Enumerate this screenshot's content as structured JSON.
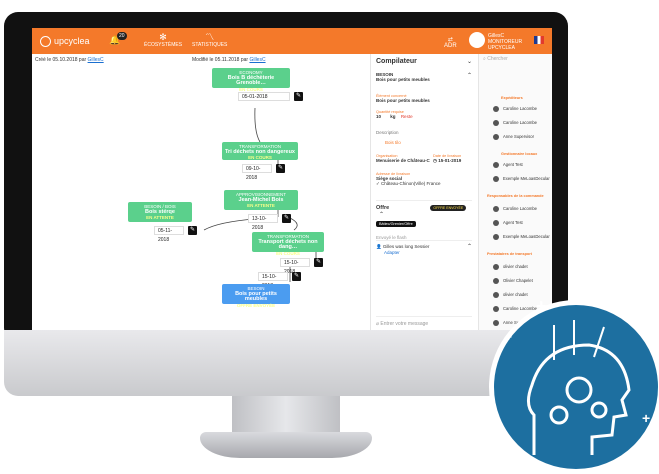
{
  "topbar": {
    "logo": "upcyclea",
    "notification_count": "20",
    "nav": [
      {
        "label": "ÉCOSYSTÈMES",
        "icon": "ecosystem-icon"
      },
      {
        "label": "STATISTIQUES",
        "icon": "stats-icon"
      }
    ],
    "adr_label": "ADR",
    "user_name": "GillesC",
    "user_role": "MONITOREUR",
    "user_org": "UPCYCLEA"
  },
  "meta": {
    "created_prefix": "Créé le 05.10.2018 par",
    "created_by": "GillesC",
    "modified_prefix": "Modifié le 05.11.2018 par",
    "modified_by": "GillesC"
  },
  "graph": {
    "nodes": [
      {
        "title": "ECONOMY",
        "name": "Bois B déchèterie Grenoble…",
        "status": "EN COURS",
        "color": "#5bd08c"
      },
      {
        "title": "TRANSFORMATION",
        "name": "Tri déchets non dangereux",
        "status": "EN COURS",
        "color": "#5bd08c"
      },
      {
        "title": "APPROVISIONNEMENT",
        "name": "Jean-Michel Bois",
        "status": "EN ATTENTE",
        "color": "#5bd08c"
      },
      {
        "title": "BESOIN / BOIS",
        "name": "Bois stérqe",
        "status": "EN ATTENTE",
        "color": "#5bd08c"
      },
      {
        "title": "TRANSFORMATION",
        "name": "Transport déchets non dang…",
        "status": "EN COURS",
        "color": "#5bd08c"
      },
      {
        "title": "BESOIN",
        "name": "Bois pour petits meubles",
        "status": "OFFRE ENVOYÉE",
        "color": "#4b9cf0"
      }
    ],
    "dates": [
      "05-01-2018",
      "09-10-2018",
      "13-10-2018",
      "05-11-2018",
      "15-10-2018",
      "15-10-2018"
    ]
  },
  "compilateur": {
    "title": "Compilateur",
    "besoin_label": "BESOIN",
    "besoin_value": "Bois pour petits meubles",
    "element_label": "Élément concerné",
    "element_value": "Bois pour petits meubles",
    "qty_label": "Quantité requise",
    "qty_value": "10",
    "qty_unit": "kg",
    "qty_status": "Reste",
    "desc_label": "Description",
    "desc_value": "Bois tilo",
    "org_label": "Organisation",
    "org_value": "Menuiserie de Château-C",
    "date_label": "Date de livraison",
    "date_value": "15-01-2019",
    "addr_label": "Adresse de livraison",
    "addr_value": "Siège social",
    "addr_city": "Château-Chinon(Ville) France",
    "offre_title": "Offre",
    "offre_badge": "OFFRE ENVOYÉE",
    "offre_tag": "Bâtiec/Grenier/Offre",
    "offre_link": "Envoyé le flash",
    "msg_sender": "Gilles was long Sessier",
    "msg_link": "Adapter",
    "message_placeholder": "Entrer votre message"
  },
  "right_panel": {
    "search_placeholder": "Chercher",
    "sections": [
      {
        "label": "Expéditeurs",
        "users": [
          "Caroline Lacombe",
          "Caroline Lacombe",
          "Anne Supervisor"
        ]
      },
      {
        "label": "Gestionnaire locaux",
        "users": [
          "Agent Test",
          "Exemple MeLoasDecular"
        ]
      },
      {
        "label": "Responsables de la commande",
        "users": [
          "Caroline Lacombe",
          "Agent Test",
          "Exemple MeLoasDecular"
        ]
      },
      {
        "label": "Prestataires de transport",
        "users": [
          "olivier chadet",
          "Olivier Chapelet",
          "olivier chadet",
          "Caroline Lacombe",
          "Anne Supervisor",
          "Above Test"
        ]
      }
    ],
    "bottom_label": "Nautique"
  }
}
